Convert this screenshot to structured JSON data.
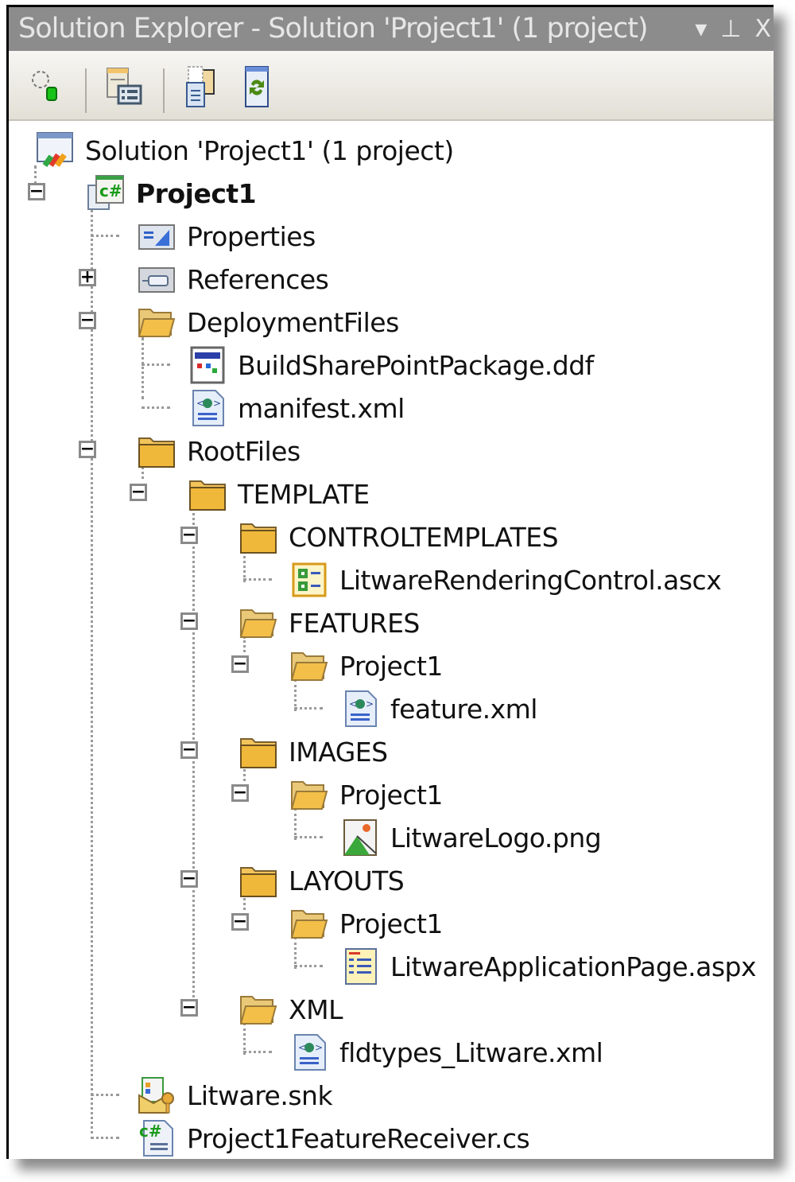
{
  "window": {
    "title": "Solution Explorer - Solution 'Project1' (1 project)",
    "controls": {
      "dropdown": "▾",
      "pin": "⊥",
      "close": "X"
    }
  },
  "toolbar": {
    "buttons": [
      {
        "name": "properties-button",
        "icon": "properties-icon"
      },
      {
        "name": "show-all-files-button",
        "icon": "show-all-files-icon"
      },
      {
        "name": "copy-website-button",
        "icon": "copy-icon"
      },
      {
        "name": "refresh-button",
        "icon": "refresh-icon"
      }
    ]
  },
  "tree": {
    "solution": "Solution 'Project1' (1 project)",
    "project": "Project1",
    "items": {
      "properties": "Properties",
      "references": "References",
      "deploymentfiles": "DeploymentFiles",
      "buildsharepointpackage": "BuildSharePointPackage.ddf",
      "manifest": "manifest.xml",
      "rootfiles": "RootFiles",
      "template": "TEMPLATE",
      "controltemplates": "CONTROLTEMPLATES",
      "litwarerenderingcontrol": "LitwareRenderingControl.ascx",
      "features": "FEATURES",
      "features_project1": "Project1",
      "feature_xml": "feature.xml",
      "images": "IMAGES",
      "images_project1": "Project1",
      "litwarelogo": "LitwareLogo.png",
      "layouts": "LAYOUTS",
      "layouts_project1": "Project1",
      "litwareapplicationpage": "LitwareApplicationPage.aspx",
      "xml": "XML",
      "fldtypes": "fldtypes_Litware.xml",
      "litware_snk": "Litware.snk",
      "featurereceiver": "Project1FeatureReceiver.cs"
    },
    "expanders": {
      "expanded": "−",
      "collapsed": "+"
    }
  },
  "colors": {
    "titlebar_bg": "#8c8c8c",
    "titlebar_text": "#e6e6e6",
    "folder": "#e8b84a",
    "csharp_green": "#1a9a1a"
  }
}
